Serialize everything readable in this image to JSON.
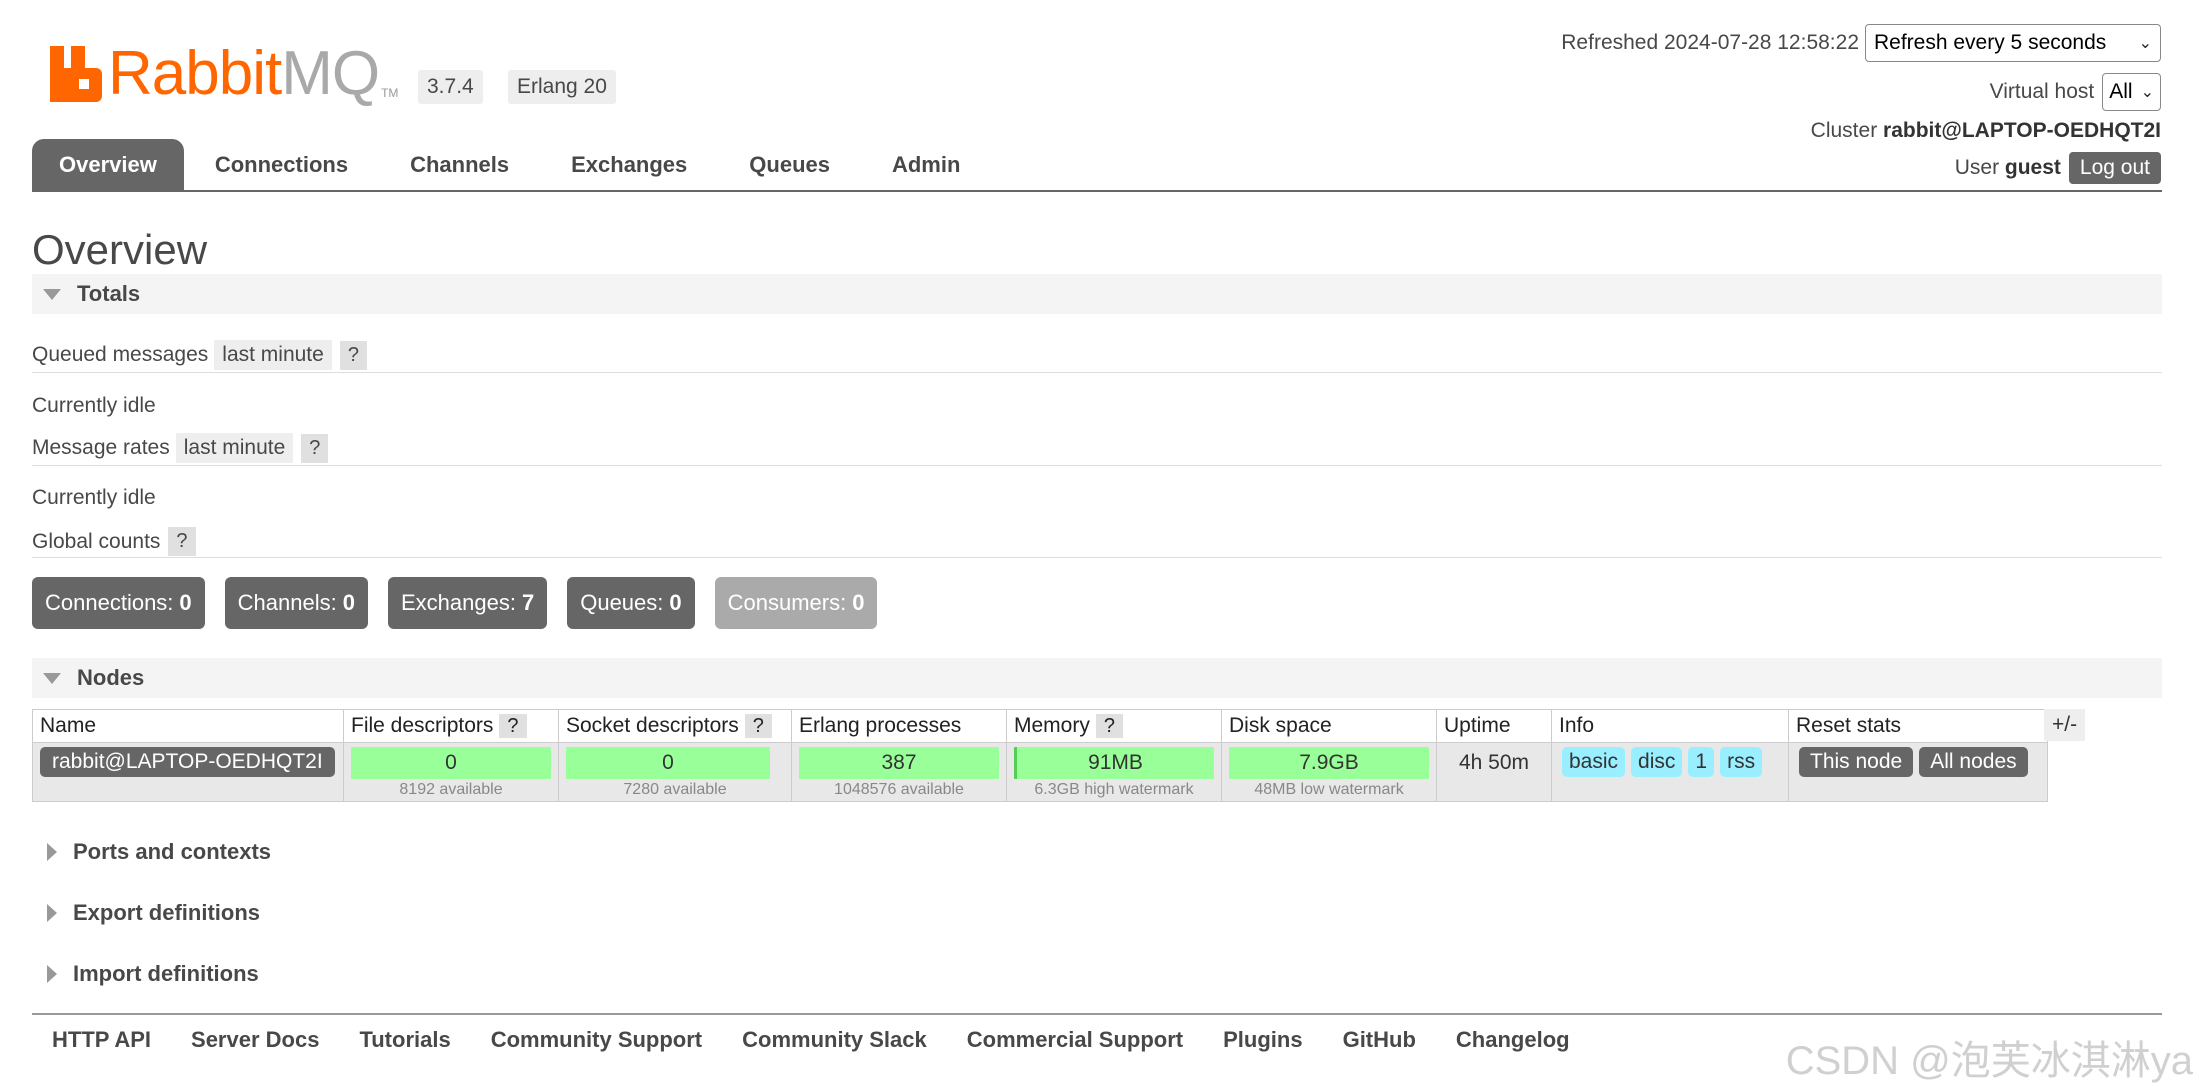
{
  "header": {
    "logo_rabbit": "Rabbit",
    "logo_mq": "MQ",
    "logo_tm": "TM",
    "version": "3.7.4",
    "erlang": "Erlang 20",
    "refreshed_label": "Refreshed",
    "refreshed_time": "2024-07-28 12:58:22",
    "refresh_select": "Refresh every 5 seconds",
    "vhost_label": "Virtual host",
    "vhost_select": "All",
    "cluster_label": "Cluster",
    "cluster_name": "rabbit@LAPTOP-OEDHQT2I",
    "user_label": "User",
    "user_name": "guest",
    "logout": "Log out"
  },
  "tabs": [
    "Overview",
    "Connections",
    "Channels",
    "Exchanges",
    "Queues",
    "Admin"
  ],
  "page_title": "Overview",
  "totals": {
    "title": "Totals",
    "queued_label": "Queued messages",
    "queued_range": "last minute",
    "qmark": "?",
    "idle1": "Currently idle",
    "rates_label": "Message rates",
    "rates_range": "last minute",
    "idle2": "Currently idle",
    "global_label": "Global counts",
    "counts": [
      {
        "label": "Connections:",
        "value": "0"
      },
      {
        "label": "Channels:",
        "value": "0"
      },
      {
        "label": "Exchanges:",
        "value": "7"
      },
      {
        "label": "Queues:",
        "value": "0"
      },
      {
        "label": "Consumers:",
        "value": "0"
      }
    ]
  },
  "nodes": {
    "title": "Nodes",
    "headers": [
      "Name",
      "File descriptors",
      "Socket descriptors",
      "Erlang processes",
      "Memory",
      "Disk space",
      "Uptime",
      "Info",
      "Reset stats"
    ],
    "plus_minus": "+/-",
    "row": {
      "name": "rabbit@LAPTOP-OEDHQT2I",
      "file_desc": "0",
      "file_desc_sub": "8192 available",
      "socket_desc": "0",
      "socket_desc_sub": "7280 available",
      "erlang_proc": "387",
      "erlang_proc_sub": "1048576 available",
      "memory": "91MB",
      "memory_sub": "6.3GB high watermark",
      "disk": "7.9GB",
      "disk_sub": "48MB low watermark",
      "uptime": "4h 50m",
      "info": [
        "basic",
        "disc",
        "1",
        "rss"
      ],
      "reset_this": "This node",
      "reset_all": "All nodes"
    }
  },
  "sections": [
    "Ports and contexts",
    "Export definitions",
    "Import definitions"
  ],
  "footer": [
    "HTTP API",
    "Server Docs",
    "Tutorials",
    "Community Support",
    "Community Slack",
    "Commercial Support",
    "Plugins",
    "GitHub",
    "Changelog"
  ],
  "watermark": "CSDN @泡芙冰淇淋ya",
  "colors": {
    "brand": "#ff6600",
    "tab_active": "#666666",
    "bar_green": "#99ff99",
    "info_cyan": "#99eeff"
  }
}
